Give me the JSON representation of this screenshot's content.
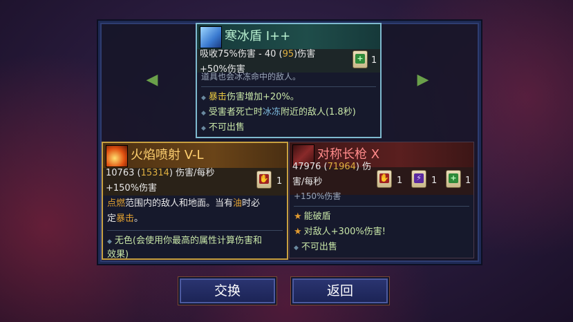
{
  "colors": {
    "accent_cyan": "#7fbad0",
    "accent_gold": "#c8a040",
    "highlight_yellow": "#e0b040",
    "positive_green": "#6aa04a"
  },
  "nav": {
    "prev_icon": "arrow-left-icon",
    "next_icon": "arrow-right-icon"
  },
  "top_item": {
    "name": "寒冰盾 I++",
    "icon": "ice-shield-icon",
    "stat_a": "吸收75%伤害 - 40 (",
    "stat_a_hl": "95",
    "stat_a_b": ")伤害",
    "stat_b": "+50%伤害",
    "scroll_count": "1",
    "partial": "道具也会冰冻命中的敌人。",
    "props": [
      {
        "pre": "",
        "key": "暴击",
        "post": "伤害增加+20%。"
      },
      {
        "pre": "受害者死亡时",
        "key": "冰冻",
        "post": "附近的敌人(1.8秒)"
      },
      {
        "pre": "不可出售",
        "key": "",
        "post": ""
      }
    ]
  },
  "left_item": {
    "name": "火焰喷射 V-L",
    "icon": "fire-blast-icon",
    "stat_a": "10763 (",
    "stat_a_hl": "15314",
    "stat_a_b": ") 伤害/每秒",
    "stat_b": "+150%伤害",
    "scroll_count": "1",
    "desc_1_key": "点燃",
    "desc_1": "范围内的敌人和地面。当有",
    "desc_1_key2": "油",
    "desc_1b": "时必",
    "desc_2": "定",
    "desc_2_key": "暴击",
    "desc_2b": "。",
    "prop": "无色(会使用你最高的属性计算伤害和",
    "prop_2": "效果)"
  },
  "right_item": {
    "name": "对称长枪 X",
    "icon": "spear-icon",
    "stat_a": "47976 (",
    "stat_a_hl": "71964",
    "stat_a_b": ") 伤",
    "stat_b": "害/每秒",
    "scroll_counts": [
      "1",
      "1",
      "1"
    ],
    "overlap": "+150%伤害",
    "props": [
      "能破盾",
      "对敌人+300%伤害!",
      "不可出售"
    ]
  },
  "buttons": {
    "swap": "交换",
    "back": "返回"
  }
}
